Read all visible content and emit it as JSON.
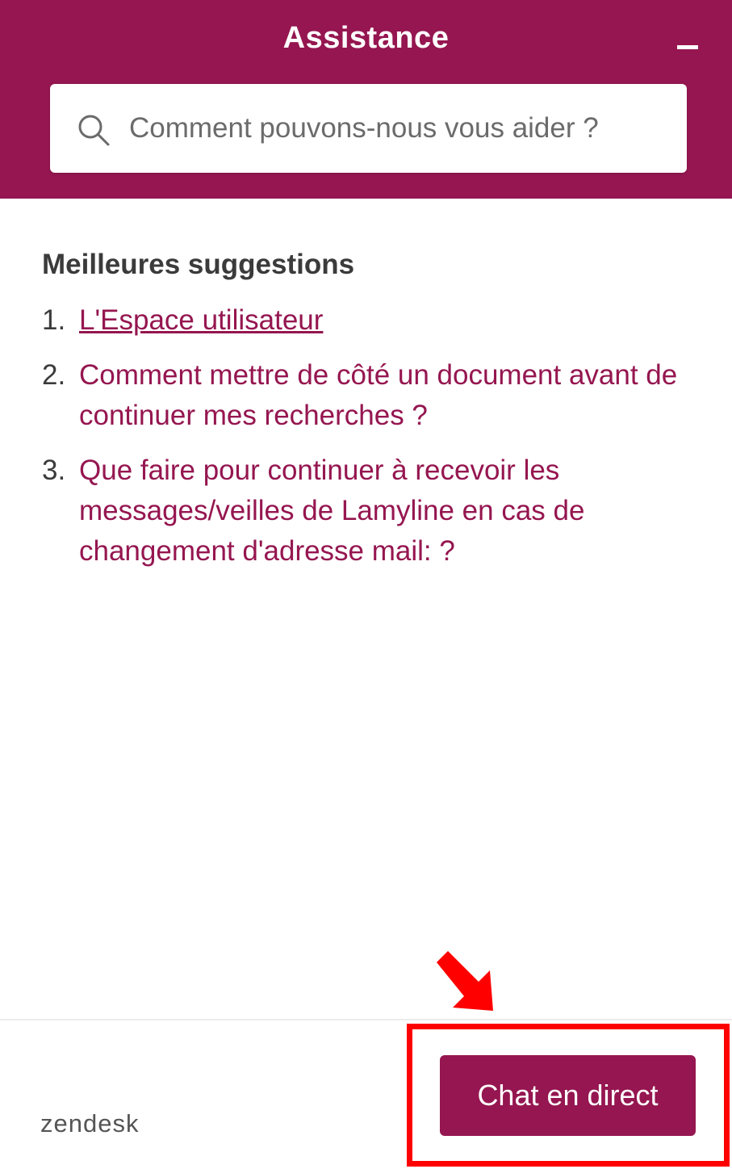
{
  "header": {
    "title": "Assistance",
    "minimize_icon": "minimize-icon"
  },
  "search": {
    "placeholder": "Comment pouvons-nous vous aider ?",
    "value": "",
    "icon": "search-icon"
  },
  "suggestions": {
    "title": "Meilleures suggestions",
    "items": [
      {
        "number": "1.",
        "label": "L'Espace utilisateur"
      },
      {
        "number": "2.",
        "label": "Comment mettre de côté un document avant de continuer mes recherches ?"
      },
      {
        "number": "3.",
        "label": "Que faire pour continuer à recevoir les messages/veilles de Lamyline en cas de changement d'adresse mail: ?"
      }
    ]
  },
  "footer": {
    "brand": "zendesk",
    "chat_label": "Chat en direct"
  },
  "colors": {
    "brand": "#951650",
    "annotation": "#ff0000"
  }
}
